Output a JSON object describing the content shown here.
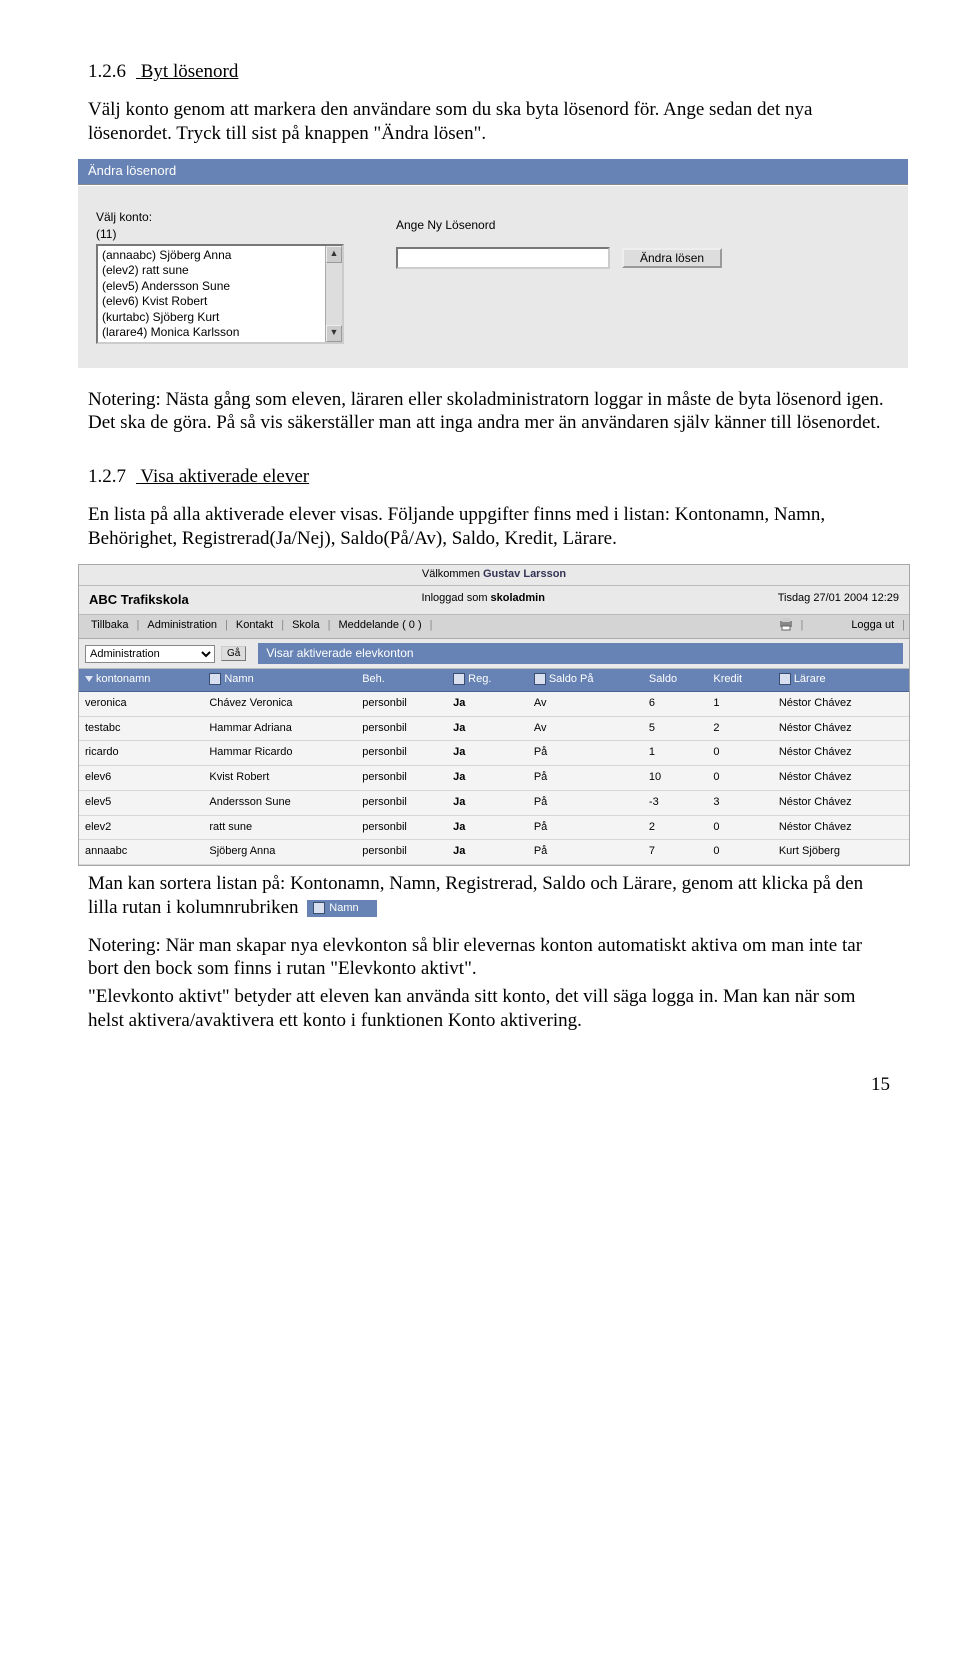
{
  "section1": {
    "num": "1.2.6",
    "title": "Byt lösenord",
    "para1": "Välj konto genom att markera den användare som du ska byta lösenord för. Ange sedan det nya lösenordet. Tryck till sist på knappen \"Ändra lösen\"."
  },
  "shot1": {
    "titlebar": "Ändra lösenord",
    "choose_label": "Välj konto:",
    "count": "(11)",
    "options": [
      "(annaabc) Sjöberg Anna",
      "(elev2) ratt sune",
      "(elev5) Andersson Sune",
      "(elev6) Kvist Robert",
      "(kurtabc) Sjöberg Kurt",
      "(larare4) Monica Karlsson"
    ],
    "new_pw_label": "Ange Ny Lösenord",
    "submit_label": "Ändra lösen"
  },
  "para_after_shot1": "Notering: Nästa gång som eleven, läraren eller skoladministratorn loggar in måste de byta lösenord igen. Det ska de göra. På så vis säkerställer man att inga andra mer än användaren själv känner till lösenordet.",
  "section2": {
    "num": "1.2.7",
    "title": "Visa aktiverade elever",
    "para1": "En lista på alla aktiverade elever visas. Följande uppgifter finns med i listan: Kontonamn, Namn, Behörighet, Registrerad(Ja/Nej), Saldo(På/Av), Saldo, Kredit, Lärare."
  },
  "shot2": {
    "welcome_prefix": "Välkommen ",
    "welcome_name": "Gustav Larsson",
    "brand": "ABC Trafikskola",
    "logged_as_prefix": "Inloggad som ",
    "logged_as_role": "skoladmin",
    "datetime": "Tisdag 27/01 2004 12:29",
    "nav": [
      "Tillbaka",
      "Administration",
      "Kontakt",
      "Skola",
      "Meddelande ( 0 )"
    ],
    "nav_logout": "Logga ut",
    "dropdown_value": "Administration",
    "go_label": "Gå",
    "caption": "Visar aktiverade elevkonton",
    "columns": [
      "kontonamn",
      "Namn",
      "Beh.",
      "Reg.",
      "Saldo På",
      "Saldo",
      "Kredit",
      "Lärare"
    ],
    "rows": [
      {
        "konto": "veronica",
        "namn": "Chávez Veronica",
        "beh": "personbil",
        "reg": "Ja",
        "saldopa": "Av",
        "saldo": "6",
        "kredit": "1",
        "larare": "Néstor Chávez"
      },
      {
        "konto": "testabc",
        "namn": "Hammar Adriana",
        "beh": "personbil",
        "reg": "Ja",
        "saldopa": "Av",
        "saldo": "5",
        "kredit": "2",
        "larare": "Néstor Chávez"
      },
      {
        "konto": "ricardo",
        "namn": "Hammar Ricardo",
        "beh": "personbil",
        "reg": "Ja",
        "saldopa": "På",
        "saldo": "1",
        "kredit": "0",
        "larare": "Néstor Chávez"
      },
      {
        "konto": "elev6",
        "namn": "Kvist Robert",
        "beh": "personbil",
        "reg": "Ja",
        "saldopa": "På",
        "saldo": "10",
        "kredit": "0",
        "larare": "Néstor Chávez"
      },
      {
        "konto": "elev5",
        "namn": "Andersson Sune",
        "beh": "personbil",
        "reg": "Ja",
        "saldopa": "På",
        "saldo": "-3",
        "kredit": "3",
        "larare": "Néstor Chávez"
      },
      {
        "konto": "elev2",
        "namn": "ratt sune",
        "beh": "personbil",
        "reg": "Ja",
        "saldopa": "På",
        "saldo": "2",
        "kredit": "0",
        "larare": "Néstor Chávez"
      },
      {
        "konto": "annaabc",
        "namn": "Sjöberg Anna",
        "beh": "personbil",
        "reg": "Ja",
        "saldopa": "På",
        "saldo": "7",
        "kredit": "0",
        "larare": "Kurt Sjöberg"
      }
    ]
  },
  "para_after_shot2_a": "Man kan sortera listan på: Kontonamn, Namn, Registrerad, Saldo och Lärare, genom att klicka på den lilla rutan i kolumnrubriken",
  "colchip_label": "Namn",
  "para_after_shot2_b": "Notering: När man skapar nya elevkonton så blir elevernas konton automatiskt aktiva om man inte tar bort den bock som finns i rutan \"Elevkonto aktivt\".",
  "para_after_shot2_c": "\"Elevkonto aktivt\" betyder att eleven kan använda sitt konto, det vill säga logga in. Man kan när som helst aktivera/avaktivera ett konto i funktionen Konto aktivering.",
  "page_number": "15"
}
